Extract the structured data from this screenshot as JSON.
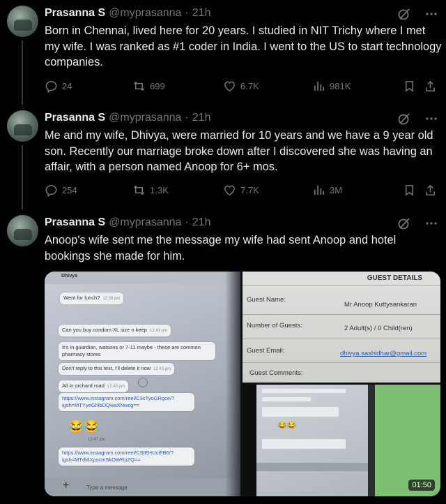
{
  "tweets": [
    {
      "name": "Prasanna S",
      "handle": "@myprasanna",
      "sep": "·",
      "time": "21h",
      "text": "Born in Chennai, lived here for 20 years. I studied in NIT Trichy where I met my wife. I was ranked as #1 coder in India. I went to the US to start technology companies.",
      "replies": "24",
      "reposts": "699",
      "likes": "6.7K",
      "views": "981K"
    },
    {
      "name": "Prasanna S",
      "handle": "@myprasanna",
      "sep": "·",
      "time": "21h",
      "text": "Me and my wife, Dhivya, were married for 10 years and we have a 9 year old son. Recently our marriage broke down after I discovered she was having an affair, with a person named Anoop for 6+ mos.",
      "replies": "254",
      "reposts": "1.3K",
      "likes": "7.7K",
      "views": "3M"
    },
    {
      "name": "Prasanna S",
      "handle": "@myprasanna",
      "sep": "·",
      "time": "21h",
      "text": "Anoop's wife sent me the message my wife had sent Anoop and hotel bookings she made for him."
    }
  ],
  "media": {
    "chat": {
      "contact": "Dhivya",
      "messages": [
        {
          "text": "Went for lunch?",
          "time": "12:39 pm"
        },
        {
          "text": "Can you buy condom XL size n keep",
          "time": "12:43 pm"
        },
        {
          "text": "It's in guardian, watsons or 7-11 maybe - these are common pharmacy stores",
          "time": ""
        },
        {
          "text": "Don't reply to this text, I'll delete it now",
          "time": "12:43 pm"
        },
        {
          "text": "All in orchard road",
          "time": "12:43 pm"
        },
        {
          "text": "https://www.instagram.com/reel/C3cTyoGRgce/?igsh=MTYyeGhlbDQwaXNwcg==",
          "time": ""
        },
        {
          "text": "https://www.instagram.com/reel/CSIEHUciFB6/?igsh=MTdtdXpscmSkOWRuZQ==",
          "time": ""
        }
      ],
      "emoji": "😂😂",
      "emoji_time": "12:47 pm",
      "input_placeholder": "Type a message",
      "plus": "+"
    },
    "guest": {
      "heading": "GUEST DETAILS",
      "rows": [
        {
          "label": "Guest Name:",
          "value": "Mr Anoop Kuttysankaran"
        },
        {
          "label": "Number of Guests:",
          "value": "2 Adult(s) / 0 Child(ren)"
        },
        {
          "label": "Guest Email:",
          "value": "dhivya.sashidhar@gmail.com"
        },
        {
          "label": "Guest Comments:",
          "value": ""
        }
      ]
    },
    "video": {
      "duration": "01:50"
    }
  }
}
